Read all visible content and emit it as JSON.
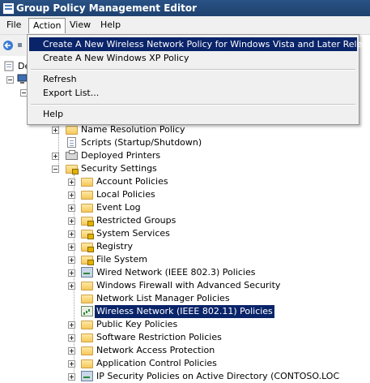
{
  "window": {
    "title": "Group Policy Management Editor"
  },
  "menubar": {
    "items": [
      "File",
      "Action",
      "View",
      "Help"
    ]
  },
  "dropdown": {
    "items": [
      "Create A New Wireless Network Policy for Windows Vista and Later Releases",
      "Create A New Windows XP Policy",
      "Refresh",
      "Export List...",
      "Help"
    ]
  },
  "tree_stub": {
    "root_fragment": "De"
  },
  "tree": {
    "rows": [
      {
        "label": "Name Resolution Policy",
        "icon": "folder-icon"
      },
      {
        "label": "Scripts (Startup/Shutdown)",
        "icon": "document-icon"
      },
      {
        "label": "Deployed Printers",
        "icon": "printer-icon"
      },
      {
        "label": "Security Settings",
        "icon": "folder-lock-icon"
      },
      {
        "label": "Account Policies",
        "icon": "folder-icon"
      },
      {
        "label": "Local Policies",
        "icon": "folder-icon"
      },
      {
        "label": "Event Log",
        "icon": "folder-icon"
      },
      {
        "label": "Restricted Groups",
        "icon": "folder-lock-icon"
      },
      {
        "label": "System Services",
        "icon": "folder-lock-icon"
      },
      {
        "label": "Registry",
        "icon": "folder-lock-icon"
      },
      {
        "label": "File System",
        "icon": "folder-lock-icon"
      },
      {
        "label": "Wired Network (IEEE 802.3) Policies",
        "icon": "wired-network-icon"
      },
      {
        "label": "Windows Firewall with Advanced Security",
        "icon": "folder-icon"
      },
      {
        "label": "Network List Manager Policies",
        "icon": "folder-icon"
      },
      {
        "label": "Wireless Network (IEEE 802.11) Policies",
        "icon": "wireless-network-icon"
      },
      {
        "label": "Public Key Policies",
        "icon": "folder-icon"
      },
      {
        "label": "Software Restriction Policies",
        "icon": "folder-icon"
      },
      {
        "label": "Network Access Protection",
        "icon": "folder-icon"
      },
      {
        "label": "Application Control Policies",
        "icon": "folder-icon"
      },
      {
        "label": "IP Security Policies on Active Directory (CONTOSO.LOC",
        "icon": "security-policy-icon"
      }
    ]
  },
  "colors": {
    "selection": "#0a246a",
    "titlebar": "#1e426f"
  }
}
